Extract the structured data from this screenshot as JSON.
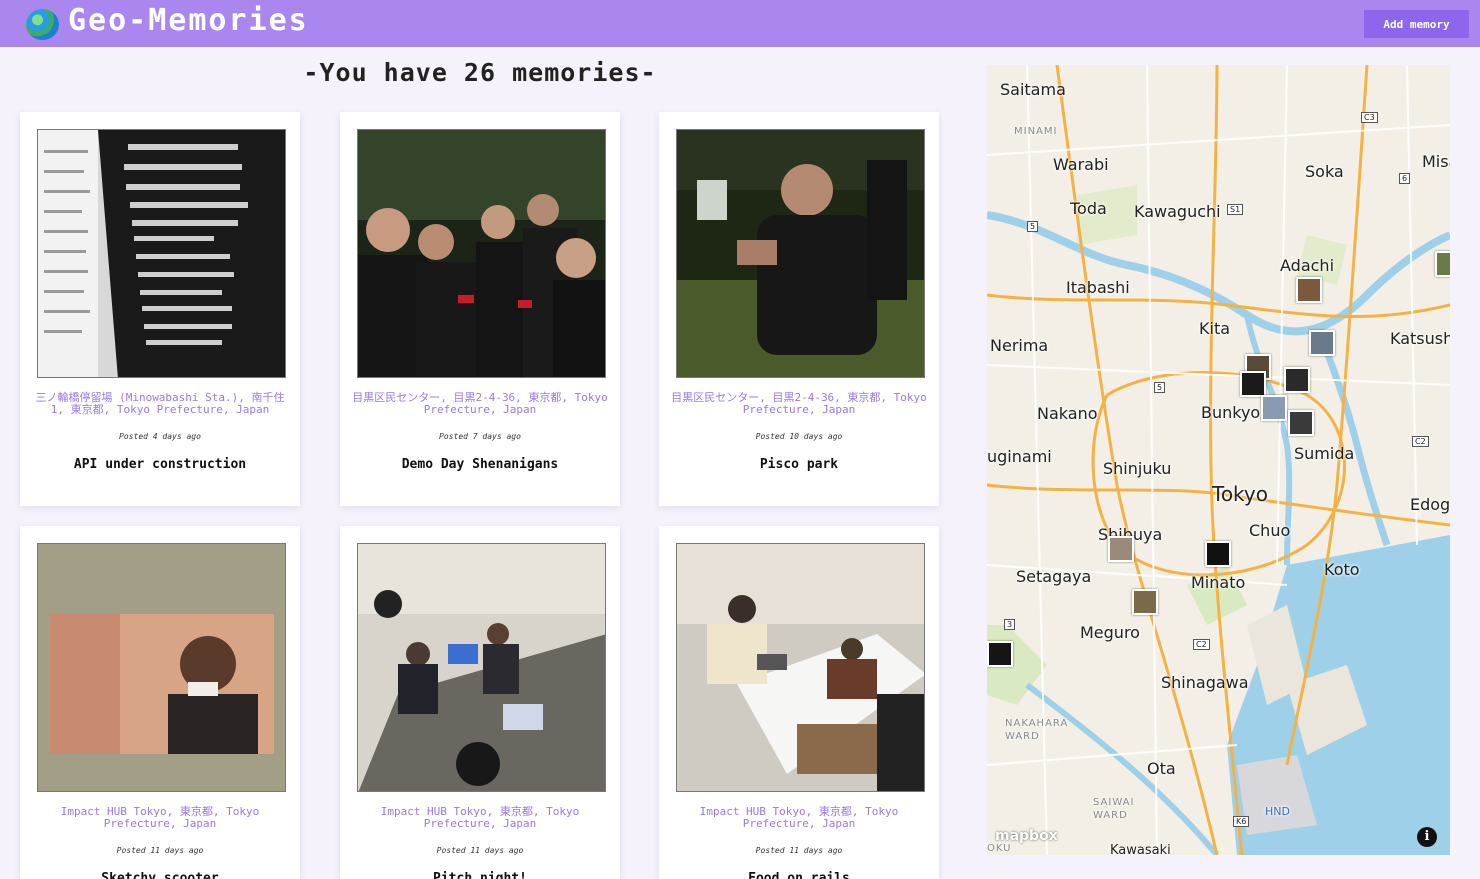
{
  "header": {
    "app_title": "Geo-Memories",
    "logo_icon": "globe-icon",
    "add_button_label": "Add memory"
  },
  "main": {
    "count_title": "-You have 26 memories-"
  },
  "memories": [
    {
      "location": "三ノ輪橋停留場 (Minowabashi Sta.), 南千住1, 東京都, Tokyo Prefecture, Japan",
      "posted": "Posted 4 days ago",
      "title": "API under construction"
    },
    {
      "location": "目黒区民センター, 目黒2-4-36, 東京都, Tokyo Prefecture, Japan",
      "posted": "Posted 7 days ago",
      "title": "Demo Day Shenanigans"
    },
    {
      "location": "目黒区民センター, 目黒2-4-36, 東京都, Tokyo Prefecture, Japan",
      "posted": "Posted 10 days ago",
      "title": "Pisco park"
    },
    {
      "location": "Impact HUB Tokyo, 東京都, Tokyo Prefecture, Japan",
      "posted": "Posted 11 days ago",
      "title": "Sketchy scooter"
    },
    {
      "location": "Impact HUB Tokyo, 東京都, Tokyo Prefecture, Japan",
      "posted": "Posted 11 days ago",
      "title": "Pitch night!"
    },
    {
      "location": "Impact HUB Tokyo, 東京都, Tokyo Prefecture, Japan",
      "posted": "Posted 11 days ago",
      "title": "Food on rails"
    }
  ],
  "map": {
    "attribution_logo": "mapbox",
    "info_icon": "info-icon",
    "places": [
      "Saitama",
      "MINAMI",
      "Warabi",
      "Soka",
      "Misa",
      "Toda",
      "Kawaguchi",
      "Adachi",
      "Itabashi",
      "Kita",
      "Nerima",
      "Katsush",
      "Nakano",
      "Bunkyo",
      "Sumida",
      "uginami",
      "Shinjuku",
      "Tokyo",
      "Edog",
      "Shibuya",
      "Chuo",
      "Setagaya",
      "Minato",
      "Koto",
      "Meguro",
      "Shinagawa",
      "NAKAHARA WARD",
      "Ota",
      "SAIWAI WARD",
      "HND",
      "Kawasaki",
      "OKU"
    ],
    "route_shields": [
      "C3",
      "6",
      "S1",
      "5",
      "5",
      "C2",
      "3",
      "C2",
      "K6"
    ]
  },
  "colors": {
    "header_bg": "#a987ef",
    "accent": "#8d66ec",
    "location_text": "#9c76ea",
    "page_bg": "#f5f2fb"
  }
}
